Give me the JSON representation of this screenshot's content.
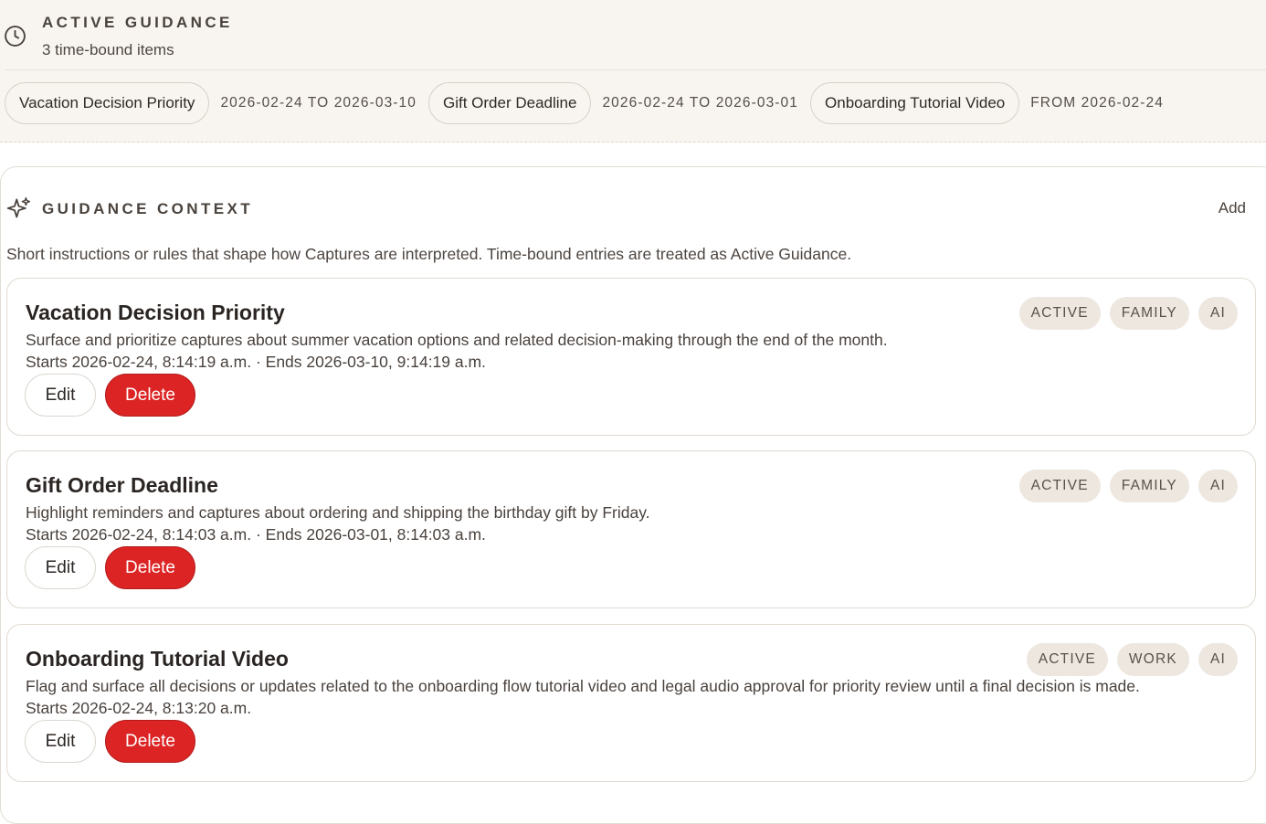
{
  "active_guidance": {
    "title": "ACTIVE GUIDANCE",
    "count_text": "3 time-bound items",
    "items": [
      {
        "label": "Vacation Decision Priority",
        "range": "2026-02-24 TO 2026-03-10"
      },
      {
        "label": "Gift Order Deadline",
        "range": "2026-02-24 TO 2026-03-01"
      },
      {
        "label": "Onboarding Tutorial Video",
        "range": "FROM 2026-02-24"
      }
    ]
  },
  "guidance_context": {
    "title": "GUIDANCE CONTEXT",
    "add_label": "Add",
    "description": "Short instructions or rules that shape how Captures are interpreted. Time-bound entries are treated as Active Guidance.",
    "entries": [
      {
        "title": "Vacation Decision Priority",
        "description": "Surface and prioritize captures about summer vacation options and related decision-making through the end of the month.",
        "dates": "Starts 2026-02-24, 8:14:19 a.m. · Ends 2026-03-10, 9:14:19 a.m.",
        "tags": [
          "ACTIVE",
          "FAMILY",
          "AI"
        ],
        "edit_label": "Edit",
        "delete_label": "Delete"
      },
      {
        "title": "Gift Order Deadline",
        "description": "Highlight reminders and captures about ordering and shipping the birthday gift by Friday.",
        "dates": "Starts 2026-02-24, 8:14:03 a.m. · Ends 2026-03-01, 8:14:03 a.m.",
        "tags": [
          "ACTIVE",
          "FAMILY",
          "AI"
        ],
        "edit_label": "Edit",
        "delete_label": "Delete"
      },
      {
        "title": "Onboarding Tutorial Video",
        "description": "Flag and surface all decisions or updates related to the onboarding flow tutorial video and legal audio approval for priority review until a final decision is made.",
        "dates": "Starts 2026-02-24, 8:13:20 a.m.",
        "tags": [
          "ACTIVE",
          "WORK",
          "AI"
        ],
        "edit_label": "Edit",
        "delete_label": "Delete"
      }
    ]
  },
  "colors": {
    "banner_bg": "#f8f5f0",
    "tag_bg": "#ede7e0",
    "delete": "#dc2424"
  },
  "icons": {
    "active_guidance": "clock-icon",
    "guidance_context": "sparkle-icon"
  }
}
